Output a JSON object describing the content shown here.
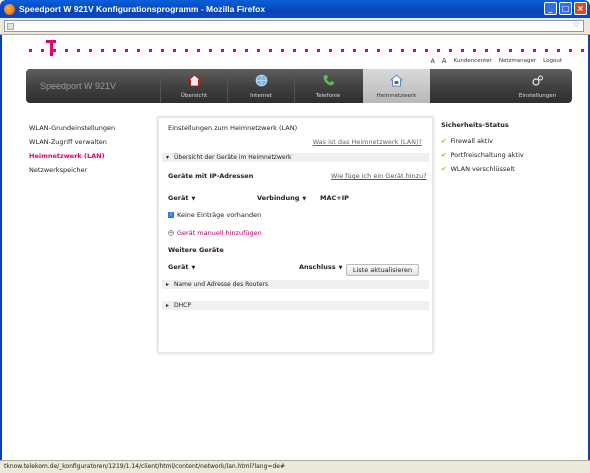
{
  "window": {
    "title": "Speedport W 921V Konfigurationsprogramm - Mozilla Firefox",
    "buttons": [
      "_",
      "□",
      "×"
    ]
  },
  "statusbar": {
    "url": "tknow.telekom.de/_konfiguratoren/1219/1.14/client/html/content/network/lan.html?lang=de#"
  },
  "header": {
    "font_small": "A",
    "font_large": "A",
    "links": [
      "Kundencenter",
      "Netzmanager",
      "Logout"
    ]
  },
  "nav": {
    "brand": "Speedport W 921V",
    "tabs": [
      {
        "label": "Übersicht",
        "icon": "house-icon"
      },
      {
        "label": "Internet",
        "icon": "globe-icon"
      },
      {
        "label": "Telefonie",
        "icon": "phone-icon"
      },
      {
        "label": "Heimnetzwerk",
        "icon": "home-network-icon",
        "active": true
      },
      {
        "label": "Einstellungen",
        "icon": "gears-icon"
      }
    ]
  },
  "leftnav": {
    "items": [
      {
        "label": "WLAN-Grundeinstellungen"
      },
      {
        "label": "WLAN-Zugriff verwalten"
      },
      {
        "label": "Heimnetzwerk (LAN)",
        "active": true
      },
      {
        "label": "Netzwerkspeicher"
      }
    ]
  },
  "panel": {
    "heading": "Einstellungen zum Heimnetzwerk (LAN)",
    "help_link": "Was ist das Heimnetzwerk (LAN)?",
    "overview_section": "Übersicht der Geräte im Heimnetzwerk",
    "ip_devices_title": "Geräte mit IP-Adressen",
    "add_help_link": "Wie füge ich ein Gerät hinzu?",
    "columns": {
      "device": "Gerät",
      "connection": "Verbindung",
      "mac_ip": "MAC+IP"
    },
    "no_entries": "Keine Einträge vorhanden",
    "add_device": "Gerät manuell hinzufügen",
    "refresh_button": "Liste aktualisieren",
    "other_devices_title": "Weitere Geräte",
    "other_columns": {
      "device": "Gerät",
      "port": "Anschluss"
    },
    "router_section": "Name und Adresse des Routers",
    "dhcp_section": "DHCP"
  },
  "security": {
    "title": "Sicherheits-Status",
    "items": [
      "Firewall aktiv",
      "Portfreischaltung aktiv",
      "WLAN verschlüsselt"
    ]
  },
  "colors": {
    "brand_magenta": "#e20074",
    "nav_dark": "#3f3f3f",
    "titlebar_blue": "#0744b8"
  }
}
